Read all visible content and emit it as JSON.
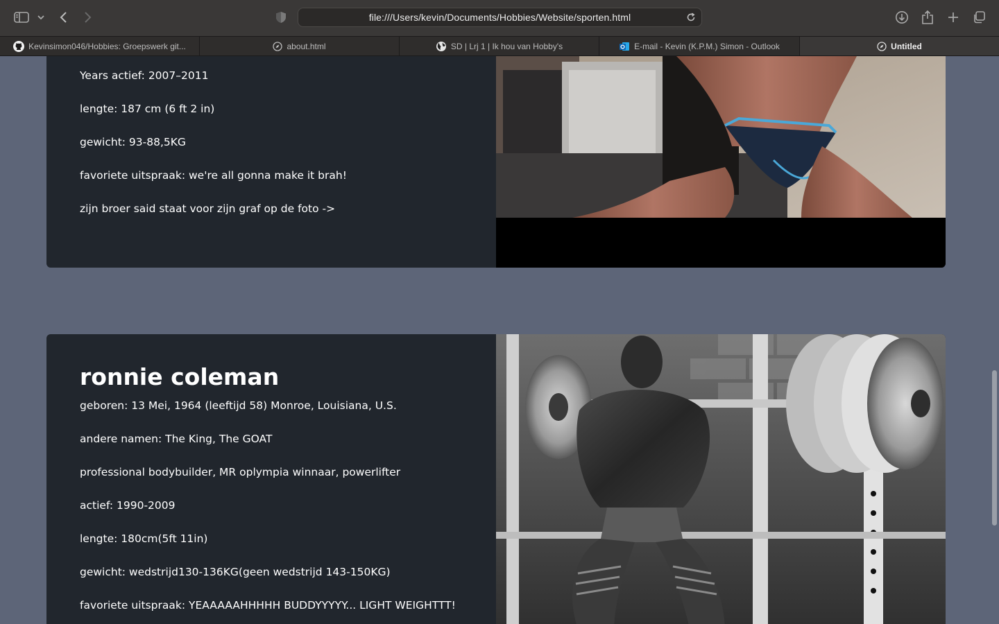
{
  "browser": {
    "url": "file:///Users/kevin/Documents/Hobbies/Website/sporten.html",
    "tabs": [
      {
        "label": "Kevinsimon046/Hobbies: Groepswerk git...",
        "icon": "github-icon",
        "active": false
      },
      {
        "label": "about.html",
        "icon": "compass-icon",
        "active": false
      },
      {
        "label": "SD | Lrj 1 | Ik hou van Hobby's",
        "icon": "globe-icon",
        "active": false
      },
      {
        "label": "E-mail - Kevin (K.P.M.) Simon - Outlook",
        "icon": "outlook-icon",
        "active": false
      },
      {
        "label": "Untitled",
        "icon": "compass-icon",
        "active": true
      }
    ]
  },
  "card1": {
    "lines": [
      "Years actief: 2007–2011",
      "lengte: 187 cm (6 ft 2 in)",
      "gewicht: 93-88,5KG",
      "favoriete uitspraak: we're all gonna make it brah!",
      "zijn broer said staat voor zijn graf op de foto ->"
    ]
  },
  "card2": {
    "title": "ronnie coleman",
    "lines": [
      "geboren: 13 Mei, 1964 (leeftijd 58) Monroe, Louisiana, U.S.",
      "andere namen: The King, The GOAT",
      "professional bodybuilder, MR oplympia winnaar, powerlifter",
      "actief: 1990-2009",
      "lengte: 180cm(5ft 11in)",
      "gewicht: wedstrijd130-136KG(geen wedstrijd 143-150KG)",
      "favoriete uitspraak: YEAAAAAHHHHH BUDDYYYYY... LIGHT WEIGHTTT!"
    ]
  },
  "colors": {
    "page_bg": "#5d6578",
    "card_bg": "#21262d",
    "text": "#ffffff"
  }
}
